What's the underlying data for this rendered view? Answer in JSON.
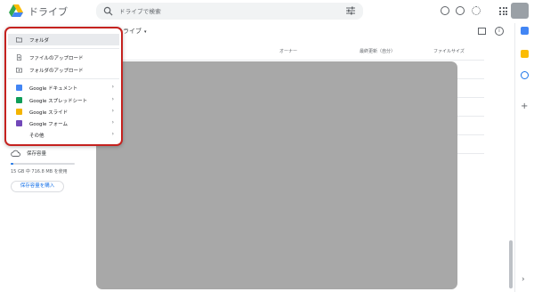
{
  "header": {
    "app_title": "ドライブ",
    "search_placeholder": "ドライブで検索"
  },
  "main": {
    "title": "ライブ",
    "columns": {
      "owner": "オーナー",
      "modified": "最終更新（自分）",
      "size": "ファイルサイズ"
    }
  },
  "storage": {
    "label": "保存容量",
    "usage": "15 GB 中 716.8 MB を使用",
    "used_fraction": 0.047,
    "buy_button": "保存容量を購入"
  },
  "new_menu": {
    "items": [
      {
        "label": "フォルダ",
        "icon": "new-folder-icon"
      },
      {
        "label": "ファイルのアップロード",
        "icon": "file-upload-icon"
      },
      {
        "label": "フォルダのアップロード",
        "icon": "folder-upload-icon"
      },
      {
        "label": "Google ドキュメント",
        "icon": "docs-icon",
        "color": "#4285f4"
      },
      {
        "label": "Google スプレッドシート",
        "icon": "sheets-icon",
        "color": "#0f9d58"
      },
      {
        "label": "Google スライド",
        "icon": "slides-icon",
        "color": "#f4b400"
      },
      {
        "label": "Google フォーム",
        "icon": "forms-icon",
        "color": "#7248b9"
      },
      {
        "label": "その他"
      }
    ]
  },
  "colors": {
    "highlight_border": "#c5221f",
    "accent": "#1a73e8",
    "redaction": "#a8a8a8"
  }
}
